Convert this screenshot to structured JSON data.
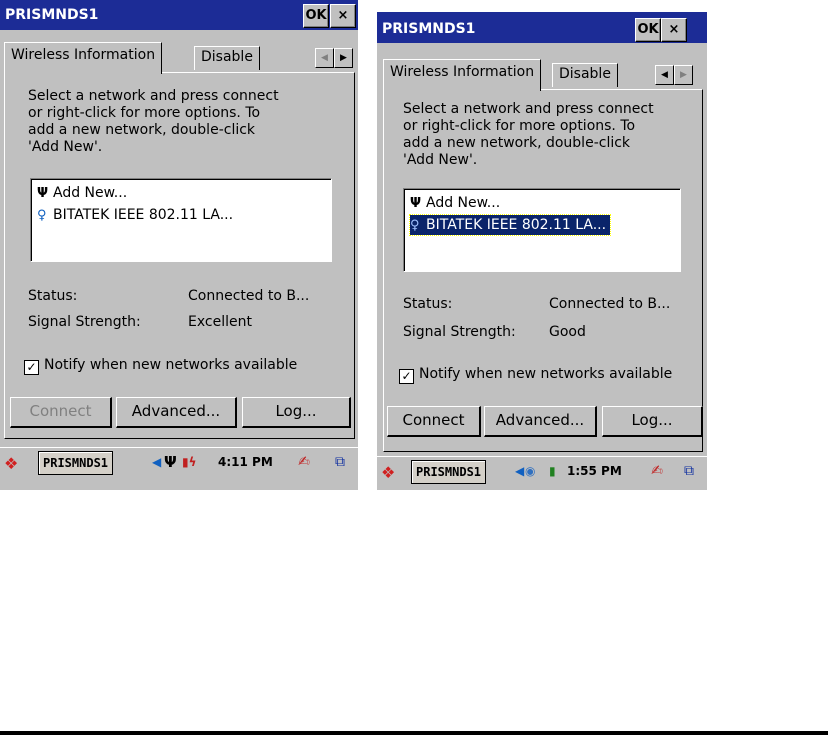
{
  "screens": [
    {
      "title": "PRISMNDS1",
      "ok_label": "OK",
      "close_label": "×",
      "tabs": [
        "Wireless Information",
        "Disable"
      ],
      "instructions": "Select a network and press connect\nor right-click for more options.  To\nadd a new network, double-click\n'Add New'.",
      "networks": [
        "Add New...",
        "BITATEK IEEE 802.11 LA..."
      ],
      "selected_network": "",
      "status_label": "Status:",
      "status_value": "Connected to B...",
      "signal_label": "Signal Strength:",
      "signal_value": "Excellent",
      "notify_label": "Notify when new networks available",
      "notify_checked": true,
      "buttons": {
        "connect": "Connect",
        "advanced": "Advanced...",
        "log": "Log..."
      },
      "connect_enabled": false,
      "taskbar": {
        "task": "PRISMNDS1",
        "time": "4:11 PM"
      }
    },
    {
      "title": "PRISMNDS1",
      "ok_label": "OK",
      "close_label": "×",
      "tabs": [
        "Wireless Information",
        "Disable"
      ],
      "instructions": "Select a network and press connect\nor right-click for more options.  To\nadd a new network, double-click\n'Add New'.",
      "networks": [
        "Add New...",
        "BITATEK IEEE 802.11 LA..."
      ],
      "selected_network": "BITATEK IEEE 802.11 LA...",
      "status_label": "Status:",
      "status_value": "Connected to B...",
      "signal_label": "Signal Strength:",
      "signal_value": "Good",
      "notify_label": "Notify when new networks available",
      "notify_checked": true,
      "buttons": {
        "connect": "Connect",
        "advanced": "Advanced...",
        "log": "Log..."
      },
      "connect_enabled": true,
      "taskbar": {
        "task": "PRISMNDS1",
        "time": "1:55 PM"
      }
    }
  ],
  "icons": {
    "antenna": "antenna-icon",
    "wireless_station": "wireless-station-icon",
    "start_flag": "windows-flag-icon",
    "battery": "battery-icon",
    "input_panel": "input-panel-icon",
    "desktop": "desktop-icon"
  },
  "colors": {
    "titlebar": "#1c2c96",
    "selection": "#0a246a",
    "face": "#c0c0c0"
  }
}
